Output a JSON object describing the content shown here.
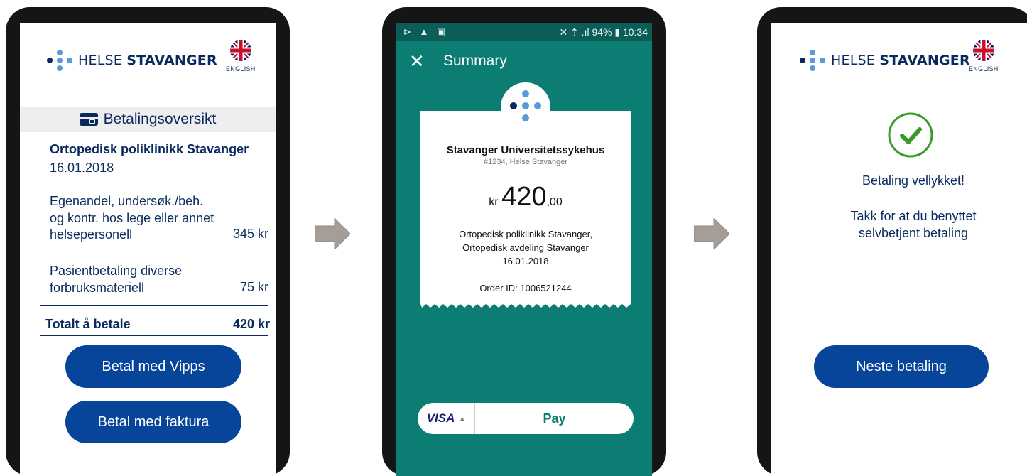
{
  "brand": {
    "name_regular": "HELSE",
    "name_bold": "STAVANGER",
    "language_label": "ENGLISH"
  },
  "screen1": {
    "section_title": "Betalingsoversikt",
    "clinic": "Ortopedisk poliklinikk Stavanger",
    "date": "16.01.2018",
    "lines": [
      {
        "desc": "Egenandel, undersøk./beh. og kontr. hos lege eller annet helsepersonell",
        "amount": "345 kr"
      },
      {
        "desc": "Pasientbetaling diverse forbruksmateriell",
        "amount": "75 kr"
      }
    ],
    "total_label": "Totalt å betale",
    "total_amount": "420 kr",
    "btn_vipps": "Betal med Vipps",
    "btn_invoice": "Betal med faktura"
  },
  "screen2": {
    "status_left": "⊳ ▲ ▣",
    "status_right": "✕ ⇡ .ıl 94% ▮ 10:34",
    "title": "Summary",
    "merchant": "Stavanger Universitetssykehus",
    "merchant_sub": "#1234, Helse Stavanger",
    "currency": "kr",
    "amount_int": "420",
    "amount_dec": ",00",
    "desc1": "Ortopedisk poliklinikk Stavanger,",
    "desc2": "Ortopedisk avdeling Stavanger",
    "desc3": "16.01.2018",
    "order": "Order ID: 1006521244",
    "card": "VISA",
    "pay": "Pay"
  },
  "screen3": {
    "success": "Betaling vellykket!",
    "thanks1": "Takk for at du benyttet",
    "thanks2": "selvbetjent betaling",
    "btn_next": "Neste betaling"
  },
  "colors": {
    "navy": "#0a2a5e",
    "button_blue": "#06459a",
    "teal": "#0b7d72",
    "success_green": "#3a9a2a",
    "arrow_gray": "#a59e98"
  },
  "icons": [
    "logo-dots-icon",
    "uk-flag-icon",
    "card-icon",
    "arrow-right-icon",
    "close-icon",
    "check-circle-icon"
  ]
}
